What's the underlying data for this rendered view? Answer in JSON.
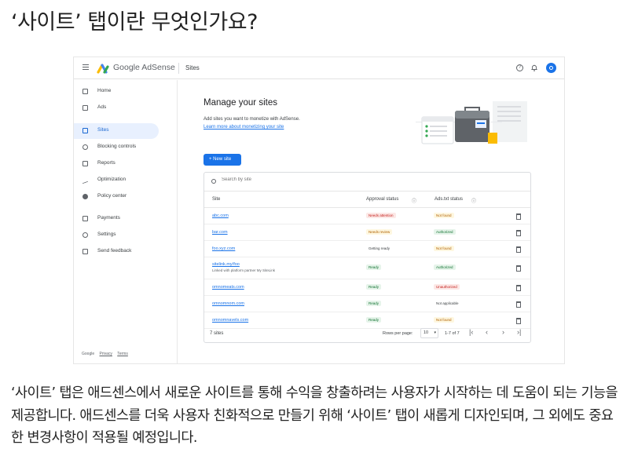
{
  "article": {
    "heading": "‘사이트’ 탭이란 무엇인가요?",
    "paragraph": "‘사이트’ 탭은 애드센스에서 새로운 사이트를 통해 수익을 창출하려는 사용자가 시작하는 데 도움이 되는 기능을 제공합니다. 애드센스를 더욱 사용자 친화적으로 만들기 위해 ‘사이트’ 탭이 새롭게 디자인되며, 그 외에도 중요한 변경사항이 적용될 예정입니다."
  },
  "app": {
    "brand": "Google AdSense",
    "section": "Sites",
    "help_glyph": "?",
    "icons": [
      "menu-icon",
      "adsense-logo",
      "help-icon",
      "bell-icon",
      "avatar"
    ],
    "accent_color": "#1a73e8"
  },
  "sidebar": {
    "items": [
      {
        "label": "Home",
        "icon": "home-icon"
      },
      {
        "label": "Ads",
        "icon": "ads-icon"
      },
      {
        "label": "Sites",
        "icon": "sites-icon",
        "active": true
      },
      {
        "label": "Blocking controls",
        "icon": "block-icon"
      },
      {
        "label": "Reports",
        "icon": "reports-icon"
      },
      {
        "label": "Optimization",
        "icon": "optimization-icon"
      },
      {
        "label": "Policy center",
        "icon": "policy-icon"
      },
      {
        "label": "Payments",
        "icon": "payments-icon"
      },
      {
        "label": "Settings",
        "icon": "settings-icon"
      },
      {
        "label": "Send feedback",
        "icon": "feedback-icon"
      }
    ],
    "footer": [
      "Google",
      "Privacy",
      "Terms"
    ]
  },
  "main": {
    "title": "Manage your sites",
    "subtitle": "Add sites you want to monetize with AdSense.",
    "link": "Learn more about monetizing your site",
    "new_button": "+   New site",
    "search_placeholder": "Search by site",
    "columns": [
      "Site",
      "Approval status",
      "Ads.txt status"
    ],
    "column_info_glyph": "ⓘ",
    "rows": [
      {
        "site": "abc.com",
        "approval": "Needs attention",
        "approval_tone": "red",
        "adstxt": "Not found",
        "adstxt_tone": "yellow"
      },
      {
        "site": "bar.com",
        "approval": "Needs review",
        "approval_tone": "yellow",
        "adstxt": "Authorized",
        "adstxt_tone": "green"
      },
      {
        "site": "foo.xyz.com",
        "approval": "Getting ready",
        "approval_tone": "plain",
        "adstxt": "Not found",
        "adstxt_tone": "yellow"
      },
      {
        "site": "sitelink.my/foo",
        "sub": "Linked with platform partner My SiteLink",
        "approval": "Ready",
        "approval_tone": "green",
        "adstxt": "Authorized",
        "adstxt_tone": "green"
      },
      {
        "site": "omnomeats.com",
        "approval": "Ready",
        "approval_tone": "green",
        "adstxt": "Unauthorized",
        "adstxt_tone": "red"
      },
      {
        "site": "omnomnom.com",
        "approval": "Ready",
        "approval_tone": "green",
        "adstxt": "Not applicable",
        "adstxt_tone": "plain"
      },
      {
        "site": "omnomnavels.com",
        "approval": "Ready",
        "approval_tone": "green",
        "adstxt": "Not found",
        "adstxt_tone": "yellow"
      }
    ],
    "footer": {
      "count": "7 sites",
      "rows_per_page_label": "Rows per page:",
      "rows_per_page": "10",
      "range": "1-7 of 7",
      "pager": [
        "|‹",
        "‹",
        "›",
        "›|"
      ]
    }
  }
}
